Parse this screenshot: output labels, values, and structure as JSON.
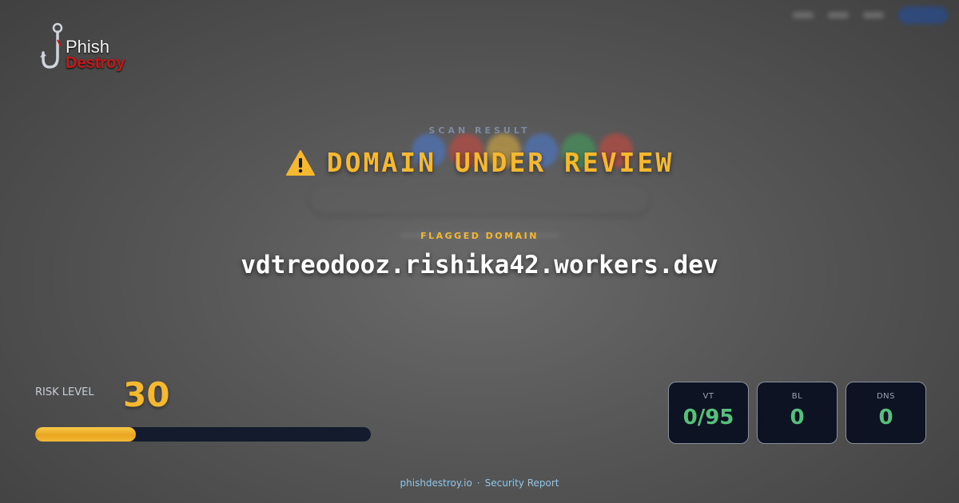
{
  "logo": {
    "line1": "Phish",
    "line2": "Destroy"
  },
  "scan": {
    "section_label": "SCAN RESULT",
    "status_title": "DOMAIN UNDER REVIEW",
    "status_icon": "warning-triangle-icon",
    "flag_label": "FLAGGED DOMAIN",
    "domain": "vdtreodooz.rishika42.workers.dev"
  },
  "risk": {
    "label": "RISK LEVEL",
    "value": "30",
    "percent": 30,
    "accent": "#f5b82e"
  },
  "stats": [
    {
      "label": "VT",
      "value": "0/95"
    },
    {
      "label": "BL",
      "value": "0"
    },
    {
      "label": "DNS",
      "value": "0"
    }
  ],
  "footer": {
    "site": "phishdestroy.io",
    "separator": "·",
    "report": "Security Report"
  },
  "colors": {
    "accent": "#f5b82e",
    "ok": "#56c07a",
    "danger": "#c41818",
    "link": "#8fc7ea"
  }
}
